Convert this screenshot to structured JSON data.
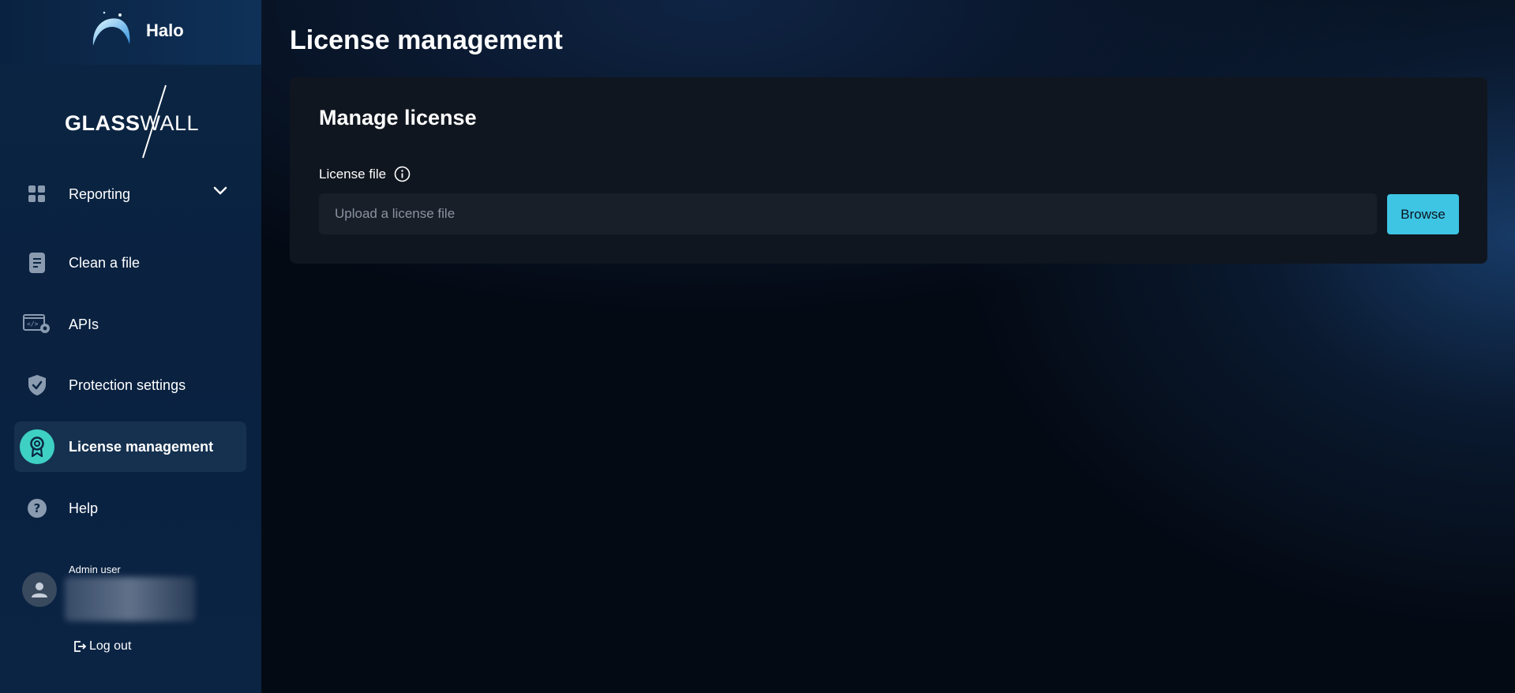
{
  "app": {
    "name": "Halo",
    "brand_logo": "GLASSWALL",
    "brand_logo_bold": "GLASS",
    "brand_logo_light": "WALL"
  },
  "sidebar": {
    "items": [
      {
        "label": "Reporting",
        "icon": "grid-icon",
        "has_dropdown": true
      },
      {
        "label": "Clean a file",
        "icon": "document-icon"
      },
      {
        "label": "APIs",
        "icon": "api-settings-icon"
      },
      {
        "label": "Protection settings",
        "icon": "shield-check-icon"
      },
      {
        "label": "License management",
        "icon": "award-ribbon-icon",
        "active": true
      },
      {
        "label": "Help",
        "icon": "help-circle-icon"
      }
    ],
    "user": {
      "role": "Admin user"
    },
    "logout_label": "Log out"
  },
  "main": {
    "title": "License management",
    "card": {
      "title": "Manage license",
      "field_label": "License file",
      "input_placeholder": "Upload a license file",
      "input_value": "",
      "browse_label": "Browse"
    }
  },
  "colors": {
    "accent": "#3ec5e4",
    "active_badge": "#3ed0c3",
    "card_bg": "#10161f",
    "sidebar_bg": "#0b2542"
  }
}
